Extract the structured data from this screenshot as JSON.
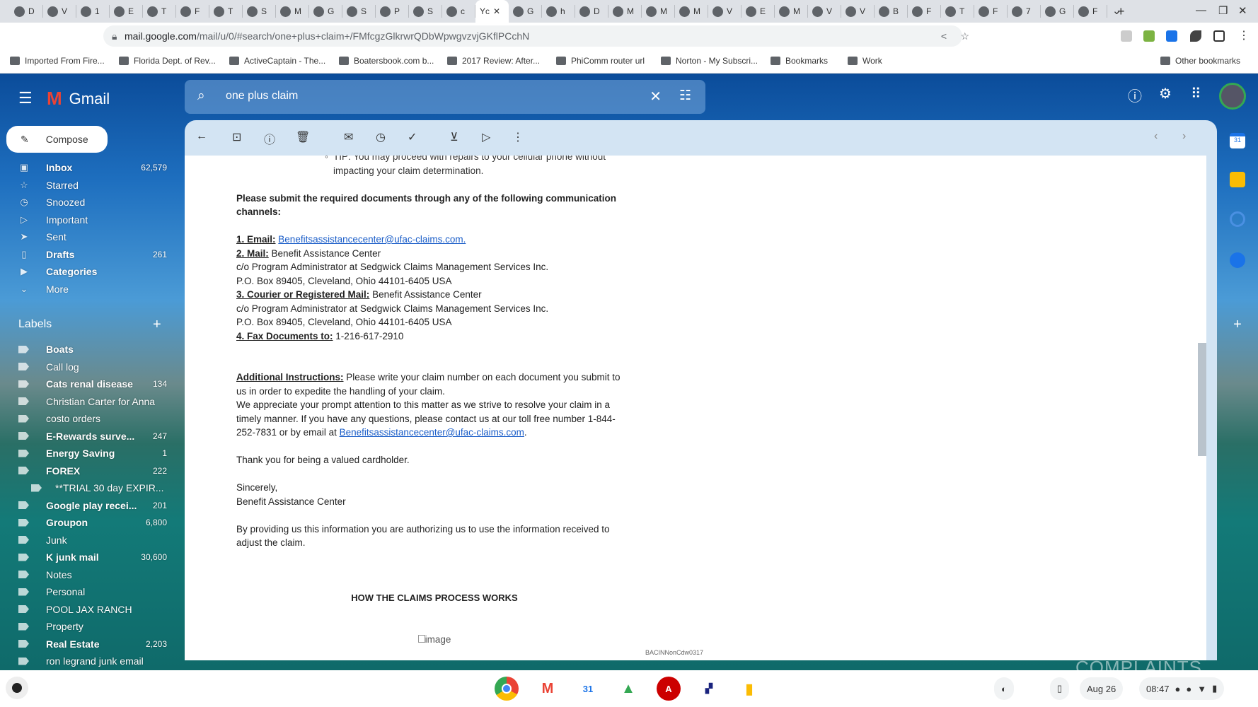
{
  "browser": {
    "tabs": [
      "D",
      "V",
      "1",
      "E",
      "T",
      "F",
      "T",
      "S",
      "M",
      "G",
      "S",
      "P",
      "S",
      "c",
      "Yc",
      "G",
      "h",
      "D",
      "M",
      "M",
      "M",
      "V",
      "E",
      "M",
      "V",
      "V",
      "B",
      "F",
      "T",
      "F",
      "7",
      "G",
      "F"
    ],
    "active_tab_index": 14,
    "url_host": "mail.google.com",
    "url_path": "/mail/u/0/#search/one+plus+claim+/FMfcgzGlkrwrQDbWpwgvzvjGKflPCchN",
    "bookmarks": [
      "Imported From Fire...",
      "Florida Dept. of Rev...",
      "ActiveCaptain - The...",
      "Boatersbook.com b...",
      "2017 Review: After...",
      "PhiComm router url",
      "Norton - My Subscri...",
      "Bookmarks",
      "Work"
    ],
    "other_bookmarks": "Other bookmarks"
  },
  "gmail": {
    "app_name": "Gmail",
    "search_query": "one plus claim",
    "compose_label": "Compose",
    "nav": [
      {
        "label": "Inbox",
        "count": "62,579",
        "bold": true,
        "icon": "inbox-icon",
        "glyph": "▣"
      },
      {
        "label": "Starred",
        "count": "",
        "bold": false,
        "icon": "star-icon",
        "glyph": "☆"
      },
      {
        "label": "Snoozed",
        "count": "",
        "bold": false,
        "icon": "clock-icon",
        "glyph": "◷"
      },
      {
        "label": "Important",
        "count": "",
        "bold": false,
        "icon": "important-icon",
        "glyph": "▷"
      },
      {
        "label": "Sent",
        "count": "",
        "bold": false,
        "icon": "send-icon",
        "glyph": "➤"
      },
      {
        "label": "Drafts",
        "count": "261",
        "bold": true,
        "icon": "draft-icon",
        "glyph": "▯"
      },
      {
        "label": "Categories",
        "count": "",
        "bold": true,
        "icon": "label-icon",
        "glyph": "▶"
      },
      {
        "label": "More",
        "count": "",
        "bold": false,
        "icon": "chevron-down-icon",
        "glyph": "⌄"
      }
    ],
    "labels_heading": "Labels",
    "labels": [
      {
        "label": "Boats",
        "count": "",
        "bold": true
      },
      {
        "label": "Call log",
        "count": "",
        "bold": false
      },
      {
        "label": "Cats renal disease",
        "count": "134",
        "bold": true
      },
      {
        "label": "Christian Carter for Anna",
        "count": "",
        "bold": false
      },
      {
        "label": "costo orders",
        "count": "",
        "bold": false
      },
      {
        "label": "E-Rewards surve...",
        "count": "247",
        "bold": true
      },
      {
        "label": "Energy Saving",
        "count": "1",
        "bold": true
      },
      {
        "label": "FOREX",
        "count": "222",
        "bold": true
      },
      {
        "label": "**TRIAL 30 day EXPIR...",
        "count": "",
        "bold": false,
        "sub": true
      },
      {
        "label": "Google play recei...",
        "count": "201",
        "bold": true
      },
      {
        "label": "Groupon",
        "count": "6,800",
        "bold": true
      },
      {
        "label": "Junk",
        "count": "",
        "bold": false
      },
      {
        "label": "K junk mail",
        "count": "30,600",
        "bold": true
      },
      {
        "label": "Notes",
        "count": "",
        "bold": false
      },
      {
        "label": "Personal",
        "count": "",
        "bold": false
      },
      {
        "label": "POOL JAX RANCH",
        "count": "",
        "bold": false
      },
      {
        "label": "Property",
        "count": "",
        "bold": false
      },
      {
        "label": "Real Estate",
        "count": "2,203",
        "bold": true
      },
      {
        "label": "ron legrand junk email",
        "count": "",
        "bold": false
      }
    ]
  },
  "email": {
    "tip": "TIP: You may proceed with repairs to your cellular phone without",
    "tip2": "impacting your claim determination.",
    "submit_heading": "Please submit the required documents through any of the following communication channels:",
    "email_label": "1. Email:",
    "email_link": "Benefitsassistancecenter@ufac-claims.com.",
    "mail_label": "2. Mail:",
    "mail_name": "Benefit Assistance Center",
    "co_line": "c/o Program Administrator at Sedgwick Claims Management Services Inc.",
    "po_line": "P.O. Box 89405, Cleveland, Ohio 44101-6405 USA",
    "courier_label": "3. Courier or Registered Mail:",
    "courier_name": "Benefit Assistance Center",
    "fax_label": "4. Fax Documents to:",
    "fax_number": "1-216-617-2910",
    "additional_label": "Additional Instructions:",
    "additional_text": "Please write your claim number on each document you submit to us in order to expedite the handling of your claim.",
    "appreciate_text": "We appreciate your prompt attention to this matter as we strive to resolve your claim in a timely manner.  If you have any questions, please contact us at our toll free number 1-844-252-7831 or by email at",
    "appreciate_link": "Benefitsassistancecenter@ufac-claims.com",
    "thanks": "Thank you for being a valued cardholder.",
    "sincerely": "Sincerely,",
    "signature": "Benefit Assistance Center",
    "authorize": "By providing us this information you are authorizing us to use the information received to adjust the claim.",
    "process_heading": "HOW THE CLAIMS PROCESS WORKS",
    "image_alt": "image",
    "footer_code": "BACINNonCdw0317"
  },
  "taskbar": {
    "date": "Aug 26",
    "time": "08:47"
  },
  "watermark": "COMPLAINTS"
}
